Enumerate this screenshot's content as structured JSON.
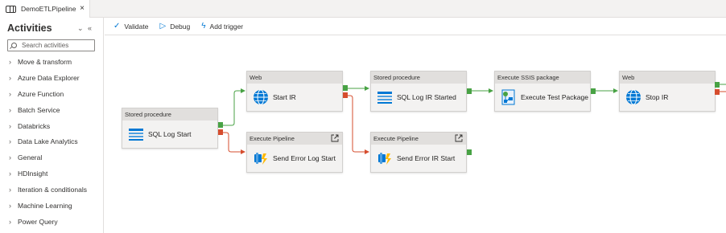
{
  "tab": {
    "title": "DemoETLPipeline",
    "close": "×"
  },
  "sidebar": {
    "title": "Activities",
    "collapse": "⌄",
    "hide": "«",
    "search_placeholder": "Search activities",
    "categories": [
      "Move & transform",
      "Azure Data Explorer",
      "Azure Function",
      "Batch Service",
      "Databricks",
      "Data Lake Analytics",
      "General",
      "HDInsight",
      "Iteration & conditionals",
      "Machine Learning",
      "Power Query"
    ]
  },
  "toolbar": {
    "validate": "Validate",
    "debug": "Debug",
    "add_trigger": "Add trigger"
  },
  "nodes": {
    "sql_log_start": {
      "type": "Stored procedure",
      "name": "SQL Log Start"
    },
    "start_ir": {
      "type": "Web",
      "name": "Start IR"
    },
    "send_error_log_start": {
      "type": "Execute Pipeline",
      "name": "Send Error Log Start"
    },
    "sql_log_ir_started": {
      "type": "Stored procedure",
      "name": "SQL Log IR Started"
    },
    "send_error_ir_start": {
      "type": "Execute Pipeline",
      "name": "Send Error IR Start"
    },
    "execute_test_package": {
      "type": "Execute SSIS package",
      "name": "Execute Test Package"
    },
    "stop_ir": {
      "type": "Web",
      "name": "Stop IR"
    }
  },
  "colors": {
    "success": "#48a244",
    "failure": "#d64d2e",
    "accent": "#0078d4"
  }
}
